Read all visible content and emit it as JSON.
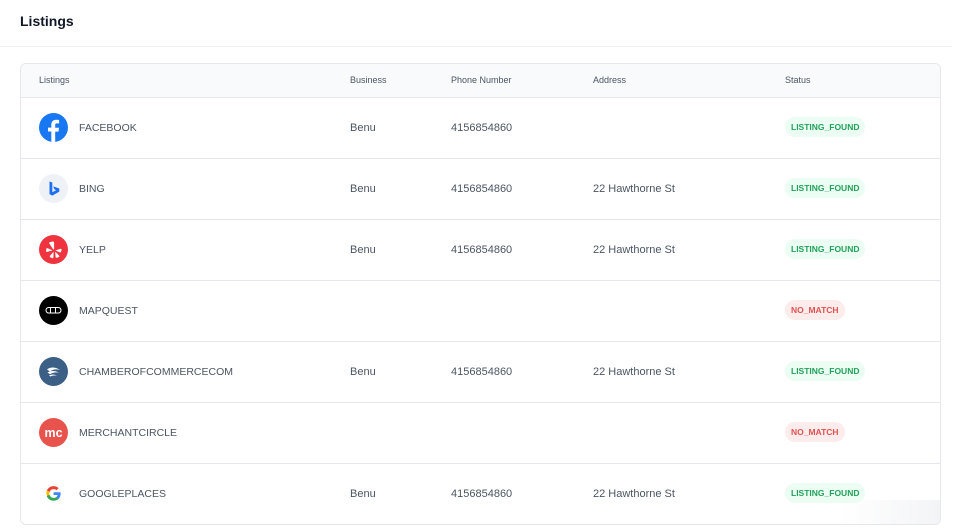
{
  "page": {
    "title": "Listings"
  },
  "table": {
    "columns": {
      "listings": "Listings",
      "business": "Business",
      "phone": "Phone Number",
      "address": "Address",
      "status": "Status"
    },
    "rows": [
      {
        "name": "FACEBOOK",
        "icon": "facebook-logo-icon",
        "business": "Benu",
        "phone": "4156854860",
        "address": "",
        "status": "LISTING_FOUND"
      },
      {
        "name": "BING",
        "icon": "bing-logo-icon",
        "business": "Benu",
        "phone": "4156854860",
        "address": "22 Hawthorne St",
        "status": "LISTING_FOUND"
      },
      {
        "name": "YELP",
        "icon": "yelp-logo-icon",
        "business": "Benu",
        "phone": "4156854860",
        "address": "22 Hawthorne St",
        "status": "LISTING_FOUND"
      },
      {
        "name": "MAPQUEST",
        "icon": "mapquest-logo-icon",
        "business": "",
        "phone": "",
        "address": "",
        "status": "NO_MATCH"
      },
      {
        "name": "CHAMBEROFCOMMERCECOM",
        "icon": "chamberofcommerce-logo-icon",
        "business": "Benu",
        "phone": "4156854860",
        "address": "22 Hawthorne St",
        "status": "LISTING_FOUND"
      },
      {
        "name": "MERCHANTCIRCLE",
        "icon": "merchantcircle-logo-icon",
        "business": "",
        "phone": "",
        "address": "",
        "status": "NO_MATCH"
      },
      {
        "name": "GOOGLEPLACES",
        "icon": "google-logo-icon",
        "business": "Benu",
        "phone": "4156854860",
        "address": "22 Hawthorne St",
        "status": "LISTING_FOUND"
      }
    ]
  },
  "logos": {
    "merchantcircle_text": "mc"
  },
  "colors": {
    "found_bg": "#ecfdf3",
    "found_text": "#22a35a",
    "nomatch_bg": "#fdecec",
    "nomatch_text": "#e05252",
    "facebook": "#1877f2",
    "yelp": "#f0343f",
    "chamber": "#3b5f85",
    "merchantcircle": "#e8544d"
  }
}
